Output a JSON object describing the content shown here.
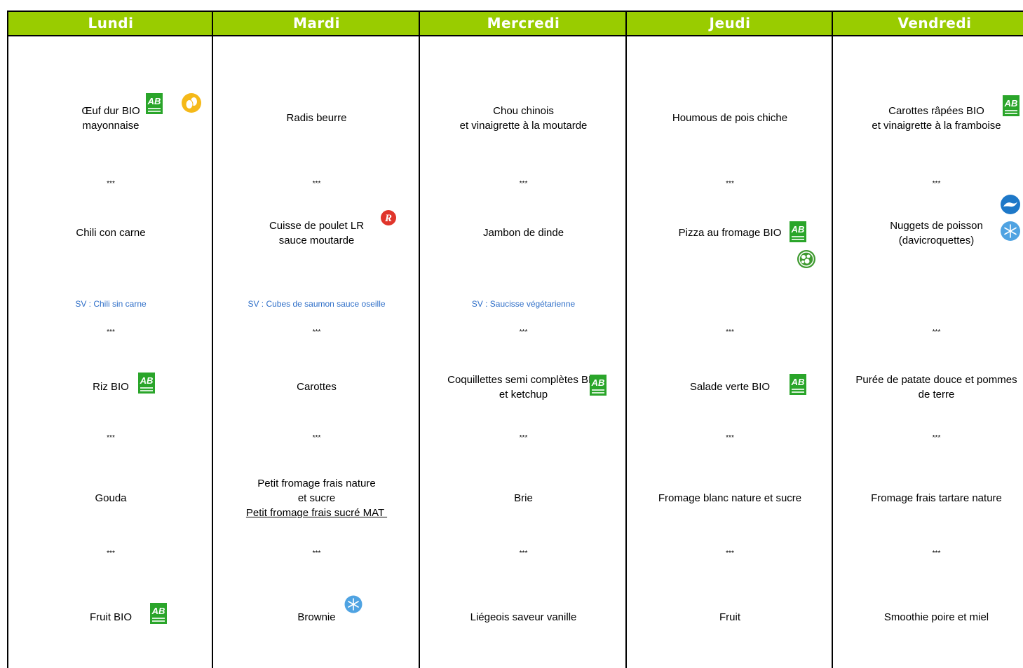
{
  "days": [
    "Lundi",
    "Mardi",
    "Mercredi",
    "Jeudi",
    "Vendredi"
  ],
  "separator": "***",
  "labels": {
    "ab_letters": "AB",
    "lr_letter": "R"
  },
  "colors": {
    "header_bg": "#99cc00",
    "header_text": "#ffffff",
    "sv_text": "#2f6fc8",
    "bio_green": "#2aa52a",
    "lr_red": "#e0352b",
    "frozen_blue": "#4fa3e2",
    "fish_blue": "#1e78c8",
    "egg_yellow": "#f5b919",
    "veggie_green": "#3e9a2f"
  },
  "menu": {
    "lundi": {
      "starter": [
        "Œuf dur BIO",
        "mayonnaise"
      ],
      "main": [
        "Chili con carne"
      ],
      "sv": "SV : Chili sin carne",
      "side": [
        "Riz BIO"
      ],
      "cheese": [
        "Gouda"
      ],
      "dessert": [
        "Fruit BIO"
      ]
    },
    "mardi": {
      "starter": [
        "Radis beurre"
      ],
      "main": [
        "Cuisse de poulet LR",
        "sauce moutarde"
      ],
      "sv": "SV : Cubes de saumon sauce oseille",
      "side": [
        "Carottes"
      ],
      "cheese": [
        "Petit fromage frais nature",
        "et sucre",
        "Petit fromage frais sucré MAT "
      ],
      "dessert": [
        "Brownie"
      ]
    },
    "mercredi": {
      "starter": [
        "Chou chinois",
        "et vinaigrette à la moutarde"
      ],
      "main": [
        "Jambon de dinde"
      ],
      "sv": "SV : Saucisse végétarienne",
      "side": [
        "Coquillettes semi complètes BIO",
        "et ketchup"
      ],
      "cheese": [
        "Brie"
      ],
      "dessert": [
        "Liégeois saveur vanille"
      ]
    },
    "jeudi": {
      "starter": [
        "Houmous de pois chiche"
      ],
      "main": [
        "Pizza au fromage BIO"
      ],
      "side": [
        "Salade verte BIO"
      ],
      "cheese": [
        "Fromage blanc nature et sucre"
      ],
      "dessert": [
        "Fruit"
      ]
    },
    "vendredi": {
      "starter": [
        "Carottes râpées BIO",
        "et vinaigrette à la framboise"
      ],
      "main": [
        "Nuggets de poisson",
        "(davicroquettes)"
      ],
      "side": [
        "Purée de patate douce et pommes",
        "de terre"
      ],
      "cheese": [
        "Fromage frais tartare nature"
      ],
      "dessert": [
        "Smoothie poire et miel"
      ]
    }
  },
  "icons": {
    "bio": "bio-label-icon",
    "label_rouge": "label-rouge-icon",
    "egg": "egg-icon",
    "frozen": "snowflake-icon",
    "fish": "sustainable-fish-icon",
    "vegetarian": "veggie-icon"
  }
}
